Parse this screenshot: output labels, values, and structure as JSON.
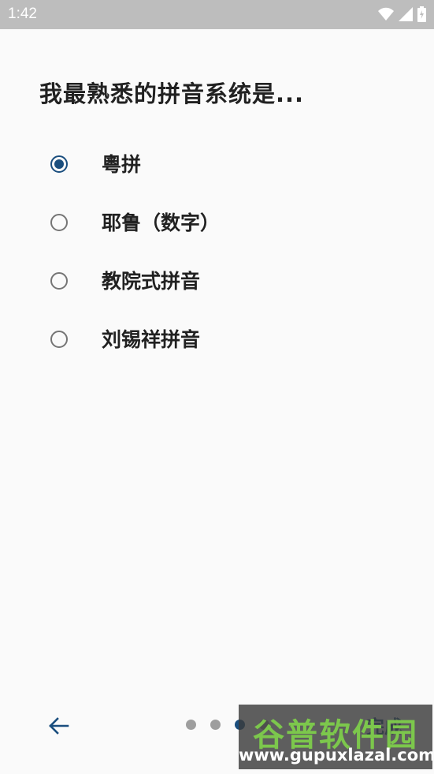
{
  "status_bar": {
    "time": "1:42",
    "icons": [
      "wifi-icon",
      "signal-icon",
      "battery-icon"
    ]
  },
  "page": {
    "title": "我最熟悉的拼音系统是..."
  },
  "options": [
    {
      "label": "粵拼",
      "selected": true
    },
    {
      "label": "耶鲁（数字）",
      "selected": false
    },
    {
      "label": "教院式拼音",
      "selected": false
    },
    {
      "label": "刘锡祥拼音",
      "selected": false
    }
  ],
  "navigation": {
    "done_label": "完成",
    "dots_total": 4,
    "active_dot": 3
  },
  "watermark": {
    "main_text": "谷普软件园",
    "url": "www.gupuxlazal.com"
  },
  "colors": {
    "accent": "#1a4e7e",
    "status_bar": "#bdbdbd",
    "background": "#fafafa"
  }
}
